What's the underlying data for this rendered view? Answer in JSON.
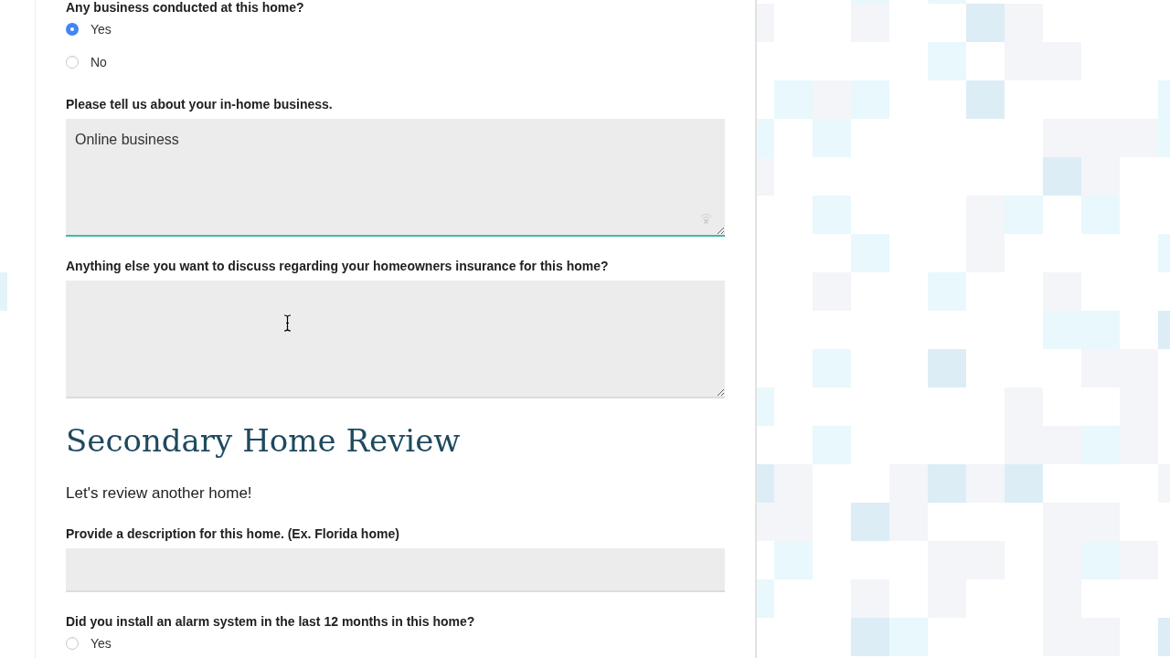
{
  "form": {
    "items": [
      {
        "kind": "radio",
        "label": "Any business conducted at this home?",
        "options": [
          {
            "label": "Yes",
            "selected": true
          },
          {
            "label": "No",
            "selected": false
          }
        ]
      },
      {
        "kind": "textarea",
        "label": "Please tell us about your in-home business.",
        "value": "Online business",
        "focused": true,
        "hovered": false
      },
      {
        "kind": "textarea",
        "label": "Anything else you want to discuss regarding your homeowners insurance for this home?",
        "focused": false,
        "hovered": true
      },
      {
        "kind": "heading",
        "text": "Secondary Home Review"
      },
      {
        "kind": "paragraph",
        "text": "Let's review another home!"
      },
      {
        "kind": "input",
        "label": "Provide a description for this home. (Ex. Florida home)",
        "focused": false,
        "hovered": false
      },
      {
        "kind": "radio",
        "label": "Did you install an alarm system in the last 12 months in this home?",
        "options": [
          {
            "label": "Yes",
            "selected": false
          }
        ]
      }
    ]
  }
}
